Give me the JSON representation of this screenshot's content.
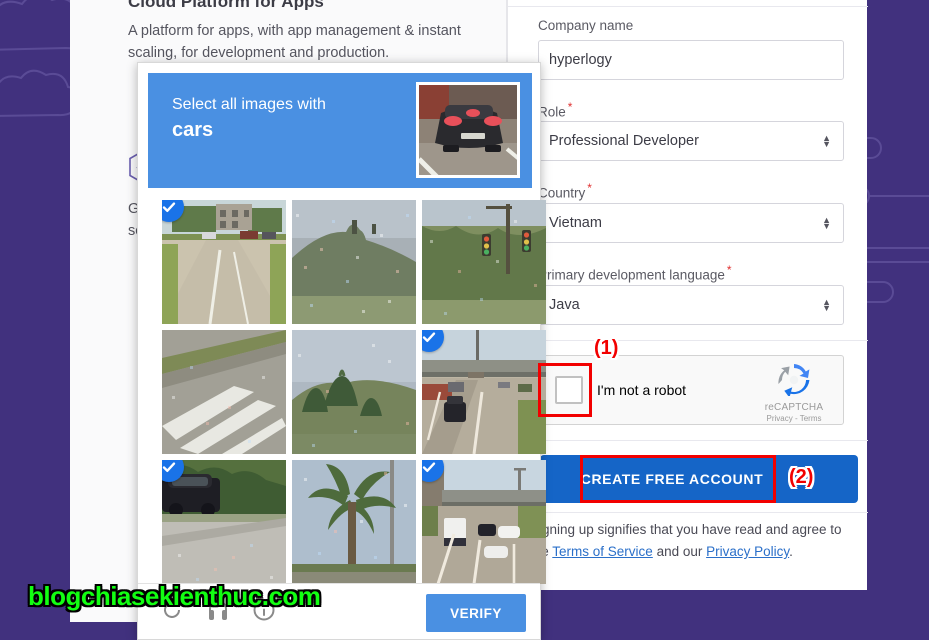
{
  "theme": {
    "page_bg": "#41317e",
    "captcha_blue": "#4a90e2",
    "cta_blue": "#1565c7",
    "badge_blue": "#1a73e8",
    "annotation_red": "#f20000",
    "watermark_green": "#12ff12"
  },
  "left_panel": {
    "headline": "Cloud Platform for Apps",
    "subtitle": "A platform for apps, with app management & instant scaling, for development and production.",
    "feature_line1": "G",
    "feature_line2": "so",
    "hex_icon": "hexagon-check-icon"
  },
  "signup_form": {
    "fields": [
      {
        "label": "Company name",
        "required": false,
        "value": "hyperlogy",
        "type": "text"
      },
      {
        "label": "Role",
        "required": true,
        "value": "Professional Developer",
        "type": "select"
      },
      {
        "label": "Country",
        "required": true,
        "value": "Vietnam",
        "type": "select"
      },
      {
        "label": "Primary development language",
        "required": true,
        "value": "Java",
        "type": "select"
      }
    ],
    "recaptcha": {
      "label": "I'm not a robot",
      "brand": "reCAPTCHA",
      "privacy": "Privacy",
      "separator": "-",
      "terms": "Terms",
      "checked": false
    },
    "submit_label": "CREATE FREE ACCOUNT",
    "legal_prefix": "Signing up signifies that you have read and agree to the ",
    "legal_link1": "Terms of Service",
    "legal_middle": " and our ",
    "legal_link2": "Privacy Policy",
    "legal_suffix": "."
  },
  "captcha": {
    "prompt_line1": "Select all images with",
    "prompt_line2": "cars",
    "example_thumb": "car-rear-view-thumbnail",
    "verify_label": "VERIFY",
    "footer_icons": [
      "reload-icon",
      "audio-challenge-icon",
      "info-icon"
    ],
    "tiles": [
      {
        "index": 0,
        "selected": true,
        "alt": "suburban-street-with-parked-cars"
      },
      {
        "index": 1,
        "selected": false,
        "alt": "noisy-hillside-foliage"
      },
      {
        "index": 2,
        "selected": false,
        "alt": "traffic-lights-behind-trees"
      },
      {
        "index": 3,
        "selected": false,
        "alt": "crosswalk-road-markings"
      },
      {
        "index": 4,
        "selected": false,
        "alt": "palm-trees-on-hillside"
      },
      {
        "index": 5,
        "selected": true,
        "alt": "highway-under-overpass-with-cars"
      },
      {
        "index": 6,
        "selected": true,
        "alt": "black-car-parked-by-curb"
      },
      {
        "index": 7,
        "selected": false,
        "alt": "tall-palm-tree-sky"
      },
      {
        "index": 8,
        "selected": true,
        "alt": "multilane-road-with-truck-and-cars"
      }
    ]
  },
  "annotations": [
    {
      "id": "1",
      "label": "(1)",
      "target": "recaptcha-checkbox"
    },
    {
      "id": "2",
      "label": "(2)",
      "target": "create-account-button"
    }
  ],
  "watermark": {
    "text": "blogchiasekienthuc.com"
  }
}
